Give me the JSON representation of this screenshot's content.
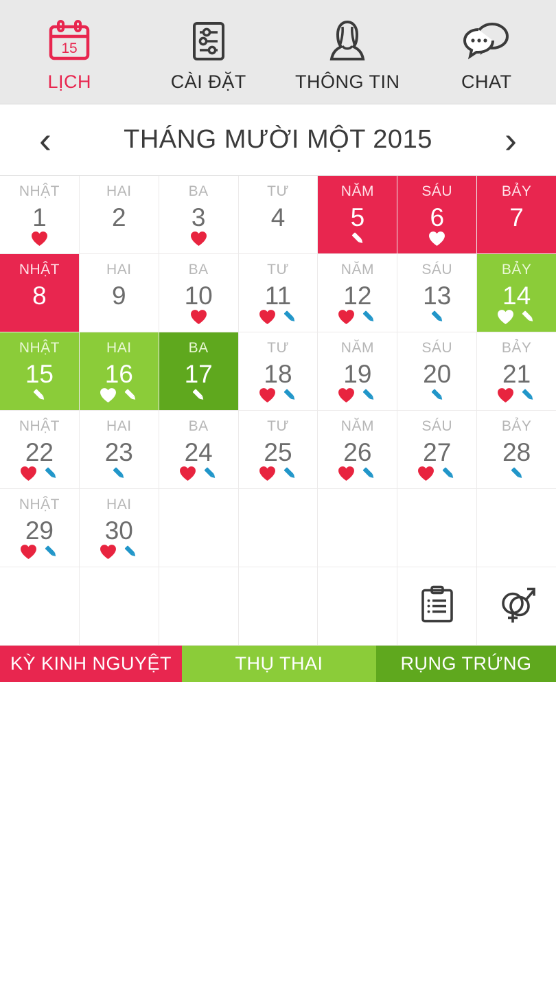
{
  "tabs": [
    {
      "label": "LỊCH",
      "icon": "calendar-icon",
      "active": true
    },
    {
      "label": "CÀI ĐẶT",
      "icon": "settings-sliders-icon",
      "active": false
    },
    {
      "label": "THÔNG TIN",
      "icon": "woman-profile-icon",
      "active": false
    },
    {
      "label": "CHAT",
      "icon": "chat-bubbles-icon",
      "active": false
    }
  ],
  "calendar_icon_day": "15",
  "header": {
    "prev_label": "‹",
    "next_label": "›",
    "title": "THÁNG MƯỜI MỘT 2015"
  },
  "weekday_names": [
    "NHẬT",
    "HAI",
    "BA",
    "TƯ",
    "NĂM",
    "SÁU",
    "BẢY"
  ],
  "weeks": [
    [
      {
        "dow": "NHẬT",
        "num": "1",
        "phase": "none",
        "heart": true,
        "pencil": false
      },
      {
        "dow": "HAI",
        "num": "2",
        "phase": "none",
        "heart": false,
        "pencil": false
      },
      {
        "dow": "BA",
        "num": "3",
        "phase": "none",
        "heart": true,
        "pencil": false
      },
      {
        "dow": "TƯ",
        "num": "4",
        "phase": "none",
        "heart": false,
        "pencil": false
      },
      {
        "dow": "NĂM",
        "num": "5",
        "phase": "period",
        "heart": false,
        "pencil": true
      },
      {
        "dow": "SÁU",
        "num": "6",
        "phase": "period",
        "heart": true,
        "pencil": false
      },
      {
        "dow": "BẢY",
        "num": "7",
        "phase": "period",
        "heart": false,
        "pencil": false
      }
    ],
    [
      {
        "dow": "NHẬT",
        "num": "8",
        "phase": "period",
        "heart": false,
        "pencil": false
      },
      {
        "dow": "HAI",
        "num": "9",
        "phase": "none",
        "heart": false,
        "pencil": false
      },
      {
        "dow": "BA",
        "num": "10",
        "phase": "none",
        "heart": true,
        "pencil": false
      },
      {
        "dow": "TƯ",
        "num": "11",
        "phase": "none",
        "heart": true,
        "pencil": true
      },
      {
        "dow": "NĂM",
        "num": "12",
        "phase": "none",
        "heart": true,
        "pencil": true
      },
      {
        "dow": "SÁU",
        "num": "13",
        "phase": "none",
        "heart": false,
        "pencil": true
      },
      {
        "dow": "BẢY",
        "num": "14",
        "phase": "fertile",
        "heart": true,
        "pencil": true
      }
    ],
    [
      {
        "dow": "NHẬT",
        "num": "15",
        "phase": "fertile",
        "heart": false,
        "pencil": true
      },
      {
        "dow": "HAI",
        "num": "16",
        "phase": "fertile",
        "heart": true,
        "pencil": true
      },
      {
        "dow": "BA",
        "num": "17",
        "phase": "ovul",
        "heart": false,
        "pencil": true
      },
      {
        "dow": "TƯ",
        "num": "18",
        "phase": "none",
        "heart": true,
        "pencil": true
      },
      {
        "dow": "NĂM",
        "num": "19",
        "phase": "none",
        "heart": true,
        "pencil": true
      },
      {
        "dow": "SÁU",
        "num": "20",
        "phase": "none",
        "heart": false,
        "pencil": true
      },
      {
        "dow": "BẢY",
        "num": "21",
        "phase": "none",
        "heart": true,
        "pencil": true
      }
    ],
    [
      {
        "dow": "NHẬT",
        "num": "22",
        "phase": "none",
        "heart": true,
        "pencil": true
      },
      {
        "dow": "HAI",
        "num": "23",
        "phase": "none",
        "heart": false,
        "pencil": true
      },
      {
        "dow": "BA",
        "num": "24",
        "phase": "none",
        "heart": true,
        "pencil": true
      },
      {
        "dow": "TƯ",
        "num": "25",
        "phase": "none",
        "heart": true,
        "pencil": true
      },
      {
        "dow": "NĂM",
        "num": "26",
        "phase": "none",
        "heart": true,
        "pencil": true
      },
      {
        "dow": "SÁU",
        "num": "27",
        "phase": "none",
        "heart": true,
        "pencil": true
      },
      {
        "dow": "BẢY",
        "num": "28",
        "phase": "none",
        "heart": false,
        "pencil": true
      }
    ],
    [
      {
        "dow": "NHẬT",
        "num": "29",
        "phase": "none",
        "heart": true,
        "pencil": true
      },
      {
        "dow": "HAI",
        "num": "30",
        "phase": "none",
        "heart": true,
        "pencil": true
      },
      {
        "dow": "",
        "num": "",
        "phase": "none",
        "heart": false,
        "pencil": false
      },
      {
        "dow": "",
        "num": "",
        "phase": "none",
        "heart": false,
        "pencil": false
      },
      {
        "dow": "",
        "num": "",
        "phase": "none",
        "heart": false,
        "pencil": false
      },
      {
        "dow": "",
        "num": "",
        "phase": "none",
        "heart": false,
        "pencil": false
      },
      {
        "dow": "",
        "num": "",
        "phase": "none",
        "heart": false,
        "pencil": false
      }
    ]
  ],
  "tools_row": {
    "notes_icon": "clipboard-notes-icon",
    "intercourse_icon": "gender-symbols-icon"
  },
  "legend": [
    {
      "label": "KỲ KINH NGUYỆT",
      "color": "#e8264f",
      "key": "period"
    },
    {
      "label": "THỤ THAI",
      "color": "#8bcc39",
      "key": "fertile"
    },
    {
      "label": "RỤNG TRỨNG",
      "color": "#5fa81e",
      "key": "ovul"
    }
  ],
  "colors": {
    "period": "#e8264f",
    "fertile": "#8bcc39",
    "ovulation": "#5fa81e",
    "heart": "#e8243f",
    "pencil": "#2196c9",
    "tabbar_bg": "#e9e9e9",
    "accent": "#e8264f"
  }
}
